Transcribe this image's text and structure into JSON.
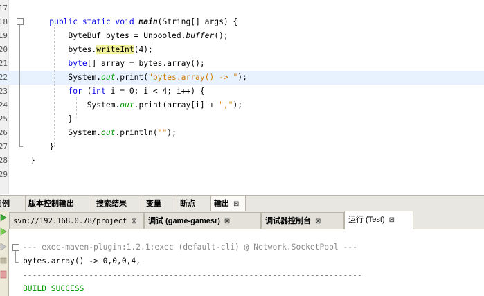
{
  "editor": {
    "lines": [
      {
        "num": "17",
        "code": []
      },
      {
        "num": "18",
        "code": [
          [
            "",
            "    "
          ],
          [
            "kw",
            "public static void "
          ],
          [
            "mth",
            "main"
          ],
          [
            "",
            "(String[] args) {"
          ]
        ]
      },
      {
        "num": "19",
        "code": [
          [
            "",
            "        ByteBuf bytes = Unpooled."
          ],
          [
            "sm",
            "buffer"
          ],
          [
            "",
            "();"
          ]
        ]
      },
      {
        "num": "20",
        "code": [
          [
            "",
            "        bytes."
          ],
          [
            "hl",
            "writeInt"
          ],
          [
            "",
            "(4);"
          ]
        ]
      },
      {
        "num": "21",
        "code": [
          [
            "",
            "        "
          ],
          [
            "kw",
            "byte"
          ],
          [
            "",
            "[] array = bytes.array();"
          ]
        ]
      },
      {
        "num": "22",
        "code": [
          [
            "",
            "        System."
          ],
          [
            "fld",
            "out"
          ],
          [
            "",
            ".print("
          ],
          [
            "str",
            "\"bytes.array() -> \""
          ],
          [
            "",
            ");"
          ]
        ]
      },
      {
        "num": "23",
        "code": [
          [
            "",
            "        "
          ],
          [
            "kw",
            "for"
          ],
          [
            "",
            " ("
          ],
          [
            "kw",
            "int"
          ],
          [
            "",
            " i = 0; i < 4; i++) {"
          ]
        ]
      },
      {
        "num": "24",
        "code": [
          [
            "",
            "            System."
          ],
          [
            "fld",
            "out"
          ],
          [
            "",
            ".print(array[i] + "
          ],
          [
            "str",
            "\",\""
          ],
          [
            "",
            ");"
          ]
        ]
      },
      {
        "num": "25",
        "code": [
          [
            "",
            "        }"
          ]
        ]
      },
      {
        "num": "26",
        "code": [
          [
            "",
            "        System."
          ],
          [
            "fld",
            "out"
          ],
          [
            "",
            ".println("
          ],
          [
            "str",
            "\"\""
          ],
          [
            "",
            ");"
          ]
        ]
      },
      {
        "num": "27",
        "code": [
          [
            "",
            "    }"
          ]
        ]
      },
      {
        "num": "28",
        "code": [
          [
            "",
            "}"
          ]
        ]
      },
      {
        "num": "29",
        "code": []
      }
    ],
    "current_line_index": 5
  },
  "bottom_tabs": [
    {
      "label": "用例",
      "close": ""
    },
    {
      "label": "版本控制输出",
      "close": ""
    },
    {
      "label": "搜索结果",
      "close": ""
    },
    {
      "label": "变量",
      "close": ""
    },
    {
      "label": "断点",
      "close": ""
    },
    {
      "label": "输出",
      "close": "⊠"
    }
  ],
  "output_tabs": [
    {
      "label": "svn://192.168.0.78/project",
      "close": "⊠"
    },
    {
      "label": "调试 (game-gamesr)",
      "close": "⊠"
    },
    {
      "label": "调试器控制台",
      "close": "⊠"
    },
    {
      "label": "运行 (Test)",
      "close": "⊠"
    }
  ],
  "output": {
    "lines": [
      {
        "cls": "gray",
        "text": "--- exec-maven-plugin:1.2.1:exec (default-cli) @ Network.SocketPool ---"
      },
      {
        "cls": "",
        "text": "bytes.array() -> 0,0,0,4,"
      },
      {
        "cls": "",
        "text": "------------------------------------------------------------------------"
      },
      {
        "cls": "green",
        "text": "BUILD SUCCESS"
      }
    ]
  },
  "colors": {
    "keyword": "#0000e6",
    "string": "#ce7b00",
    "field": "#009900",
    "success": "#009900"
  }
}
